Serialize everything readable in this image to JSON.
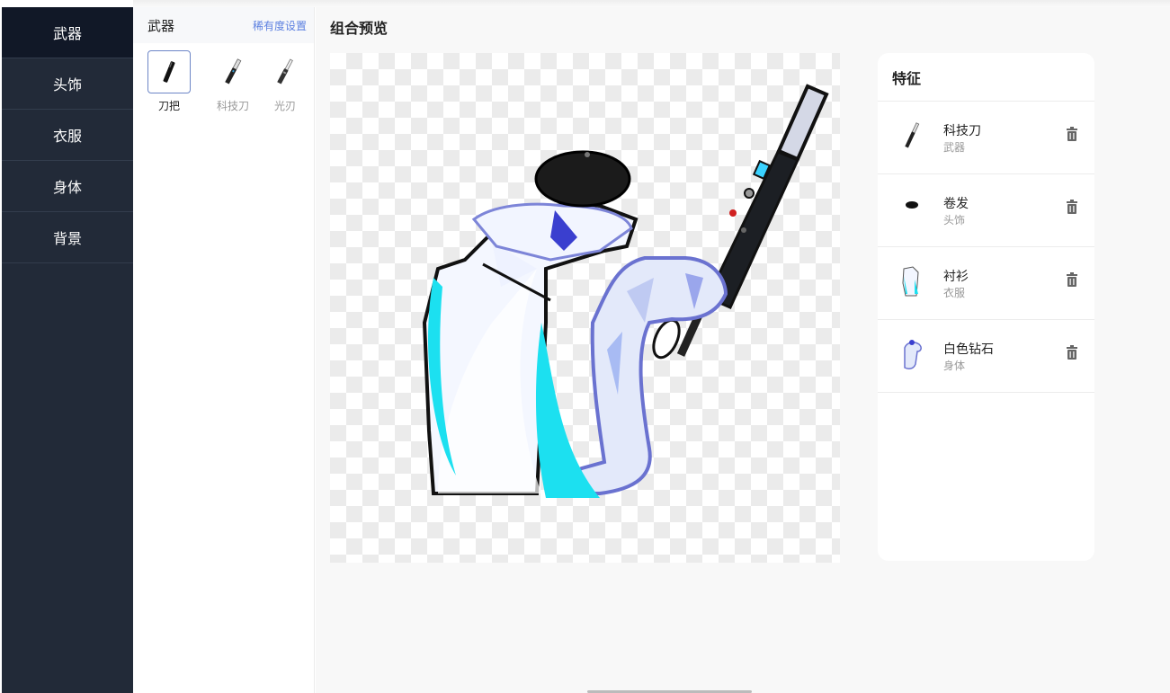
{
  "nav": {
    "items": [
      {
        "label": "武器"
      },
      {
        "label": "头饰"
      },
      {
        "label": "衣服"
      },
      {
        "label": "身体"
      },
      {
        "label": "背景"
      }
    ]
  },
  "panel": {
    "title": "武器",
    "rarity_link": "稀有度设置",
    "items": [
      {
        "label": "刀把",
        "icon": "knife-handle-icon",
        "selected": true
      },
      {
        "label": "科技刀",
        "icon": "tech-knife-icon",
        "selected": false
      },
      {
        "label": "光刃",
        "icon": "light-blade-icon",
        "selected": false
      }
    ]
  },
  "preview": {
    "title": "组合预览"
  },
  "features": {
    "title": "特征",
    "items": [
      {
        "name": "科技刀",
        "category": "武器",
        "icon": "tech-knife-icon"
      },
      {
        "name": "卷发",
        "category": "头饰",
        "icon": "curly-hair-icon"
      },
      {
        "name": "衬衫",
        "category": "衣服",
        "icon": "shirt-icon"
      },
      {
        "name": "白色钻石",
        "category": "身体",
        "icon": "white-diamond-body-icon"
      }
    ]
  },
  "colors": {
    "nav_bg": "#222a38",
    "nav_active": "#111827",
    "link": "#5b7fe0",
    "selected_border": "#6d86c7"
  }
}
